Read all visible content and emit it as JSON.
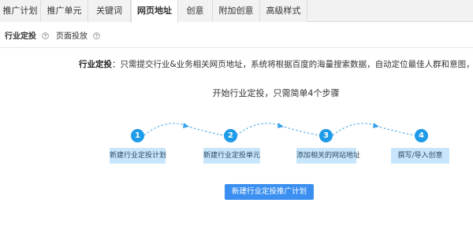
{
  "tabs": [
    {
      "label": "推广计划"
    },
    {
      "label": "推广单元"
    },
    {
      "label": "关键词"
    },
    {
      "label": "网页地址",
      "active": true
    },
    {
      "label": "创意"
    },
    {
      "label": "附加创意"
    },
    {
      "label": "高级样式"
    }
  ],
  "subtabs": [
    {
      "label": "行业定投",
      "active": true
    },
    {
      "label": "页面投放"
    }
  ],
  "description": {
    "label": "行业定投",
    "text": "：只需提交行业&业务相关网页地址，系统将根据百度的海量搜索数据，自动定位最佳人群和意图，捕捉优质流量"
  },
  "steps_title": "开始行业定投，只需简单4个步骤",
  "steps": [
    {
      "number": "1",
      "label": "新建行业定投计划"
    },
    {
      "number": "2",
      "label": "新建行业定投单元"
    },
    {
      "number": "3",
      "label": "添加相关的网站地址"
    },
    {
      "number": "4",
      "label": "撰写/导入创意"
    }
  ],
  "primary_button": "新建行业定投推广计划",
  "colors": {
    "accent": "#1e9be8",
    "step_box": "#c8e6fb",
    "button": "#3a8ff0"
  },
  "icons": {
    "help": "help-circle-icon"
  }
}
